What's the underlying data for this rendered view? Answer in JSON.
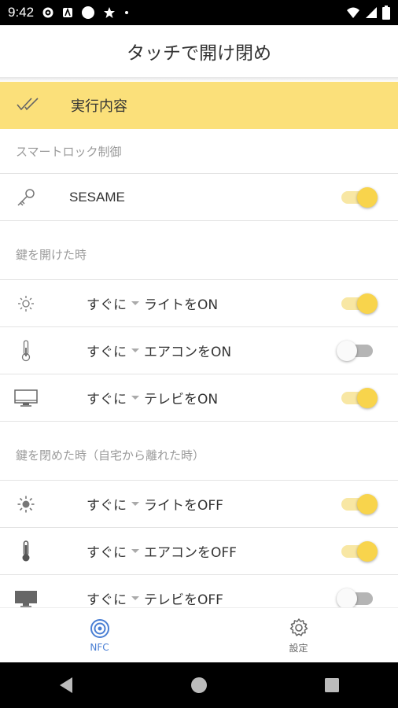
{
  "status_bar": {
    "time": "9:42"
  },
  "app_bar": {
    "title": "タッチで開け閉め"
  },
  "action_header": {
    "label": "実行内容",
    "icon": "double-check-icon"
  },
  "sections": {
    "smartlock": {
      "title": "スマートロック制御"
    },
    "on_open": {
      "title": "鍵を開けた時"
    },
    "on_close": {
      "title": "鍵を閉めた時（自宅から離れた時）"
    }
  },
  "smartlock_row": {
    "label": "SESAME",
    "toggle": true,
    "icon": "key-icon"
  },
  "open_rows": [
    {
      "timing": "すぐに",
      "device": "ライトをON",
      "toggle": true,
      "icon": "sun-outline-icon"
    },
    {
      "timing": "すぐに",
      "device": "エアコンをON",
      "toggle": false,
      "icon": "thermometer-icon"
    },
    {
      "timing": "すぐに",
      "device": "テレビをON",
      "toggle": true,
      "icon": "monitor-outline-icon"
    }
  ],
  "close_rows": [
    {
      "timing": "すぐに",
      "device": "ライトをOFF",
      "toggle": true,
      "icon": "sun-filled-icon"
    },
    {
      "timing": "すぐに",
      "device": "エアコンをOFF",
      "toggle": true,
      "icon": "thermometer-icon"
    },
    {
      "timing": "すぐに",
      "device": "テレビをOFF",
      "toggle": false,
      "icon": "monitor-filled-icon"
    }
  ],
  "bottom_nav": [
    {
      "label": "NFC",
      "active": true,
      "icon": "nfc-icon"
    },
    {
      "label": "設定",
      "active": false,
      "icon": "gear-icon"
    }
  ],
  "colors": {
    "accent_yellow": "#fbe07a",
    "toggle_knob_on": "#f8d44c",
    "nav_active": "#4a7fd4"
  }
}
